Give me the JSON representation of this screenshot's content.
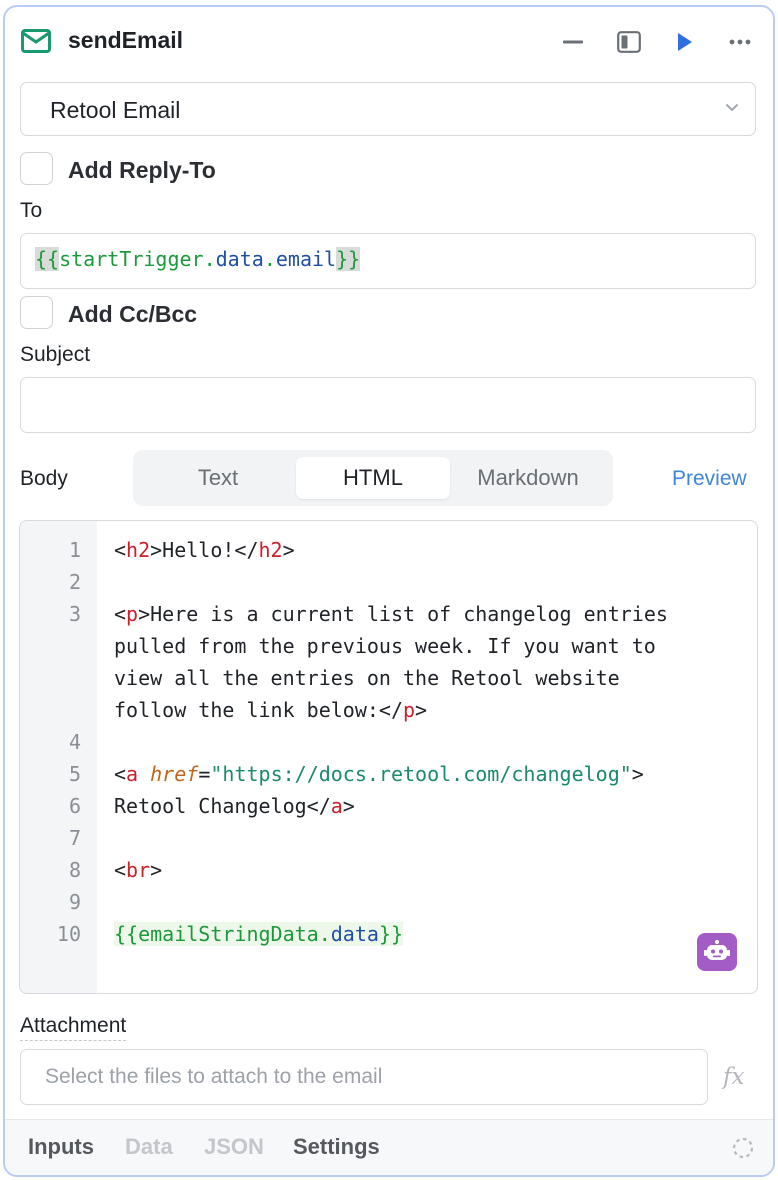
{
  "header": {
    "title": "sendEmail",
    "icons": [
      "mail-icon",
      "minimize-icon",
      "panel-toggle-icon",
      "run-icon",
      "more-icon"
    ],
    "accent_color": "#1a9a6c",
    "run_color": "#2f6fe0"
  },
  "resource": {
    "selected": "Retool Email"
  },
  "reply_to": {
    "label": "Add Reply-To",
    "checked": false
  },
  "to": {
    "label": "To",
    "value_open": "{{",
    "value_obj": "startTrigger",
    "value_dot1": ".",
    "value_prop1": "data",
    "value_dot2": ".",
    "value_prop2": "email",
    "value_close": "}}"
  },
  "cc_bcc": {
    "label": "Add Cc/Bcc",
    "checked": false
  },
  "subject": {
    "label": "Subject",
    "value": ""
  },
  "body": {
    "label": "Body",
    "tabs": [
      "Text",
      "HTML",
      "Markdown"
    ],
    "active_tab": "HTML",
    "preview_label": "Preview"
  },
  "editor": {
    "line_numbers": [
      "1",
      "2",
      "3",
      "4",
      "5",
      "6",
      "7",
      "8",
      "9",
      "10"
    ],
    "l1": {
      "o": "<",
      "t": "h2",
      "m": ">Hello!</",
      "t2": "h2",
      "c": ">"
    },
    "l3a": {
      "o": "<",
      "t": "p",
      "m": ">Here is a current list of changelog entries"
    },
    "l3b": "pulled from the previous week. If you want to",
    "l3c": "view all the entries on the Retool website",
    "l3d": {
      "m": "follow the link below:</",
      "t": "p",
      "c": ">"
    },
    "l5": {
      "o": "<",
      "t": "a",
      "sp": " ",
      "attr": "href",
      "eq": "=",
      "str": "\"https://docs.retool.com/changelog\"",
      "c": ">"
    },
    "l6": {
      "m": "Retool Changelog</",
      "t": "a",
      "c": ">"
    },
    "l8": {
      "o": "<",
      "t": "br",
      "c": ">"
    },
    "l10": {
      "open": "{{",
      "obj": "emailStringData",
      "dot": ".",
      "prop": "data",
      "close": "}}"
    },
    "assistant_icon": "robot-icon"
  },
  "attachment": {
    "label": "Attachment",
    "placeholder": "Select the files to attach to the email",
    "fx_label": "fx"
  },
  "footer": {
    "tabs": [
      "Inputs",
      "Data",
      "JSON",
      "Settings"
    ],
    "status_icon": "loading-spinner-icon"
  }
}
